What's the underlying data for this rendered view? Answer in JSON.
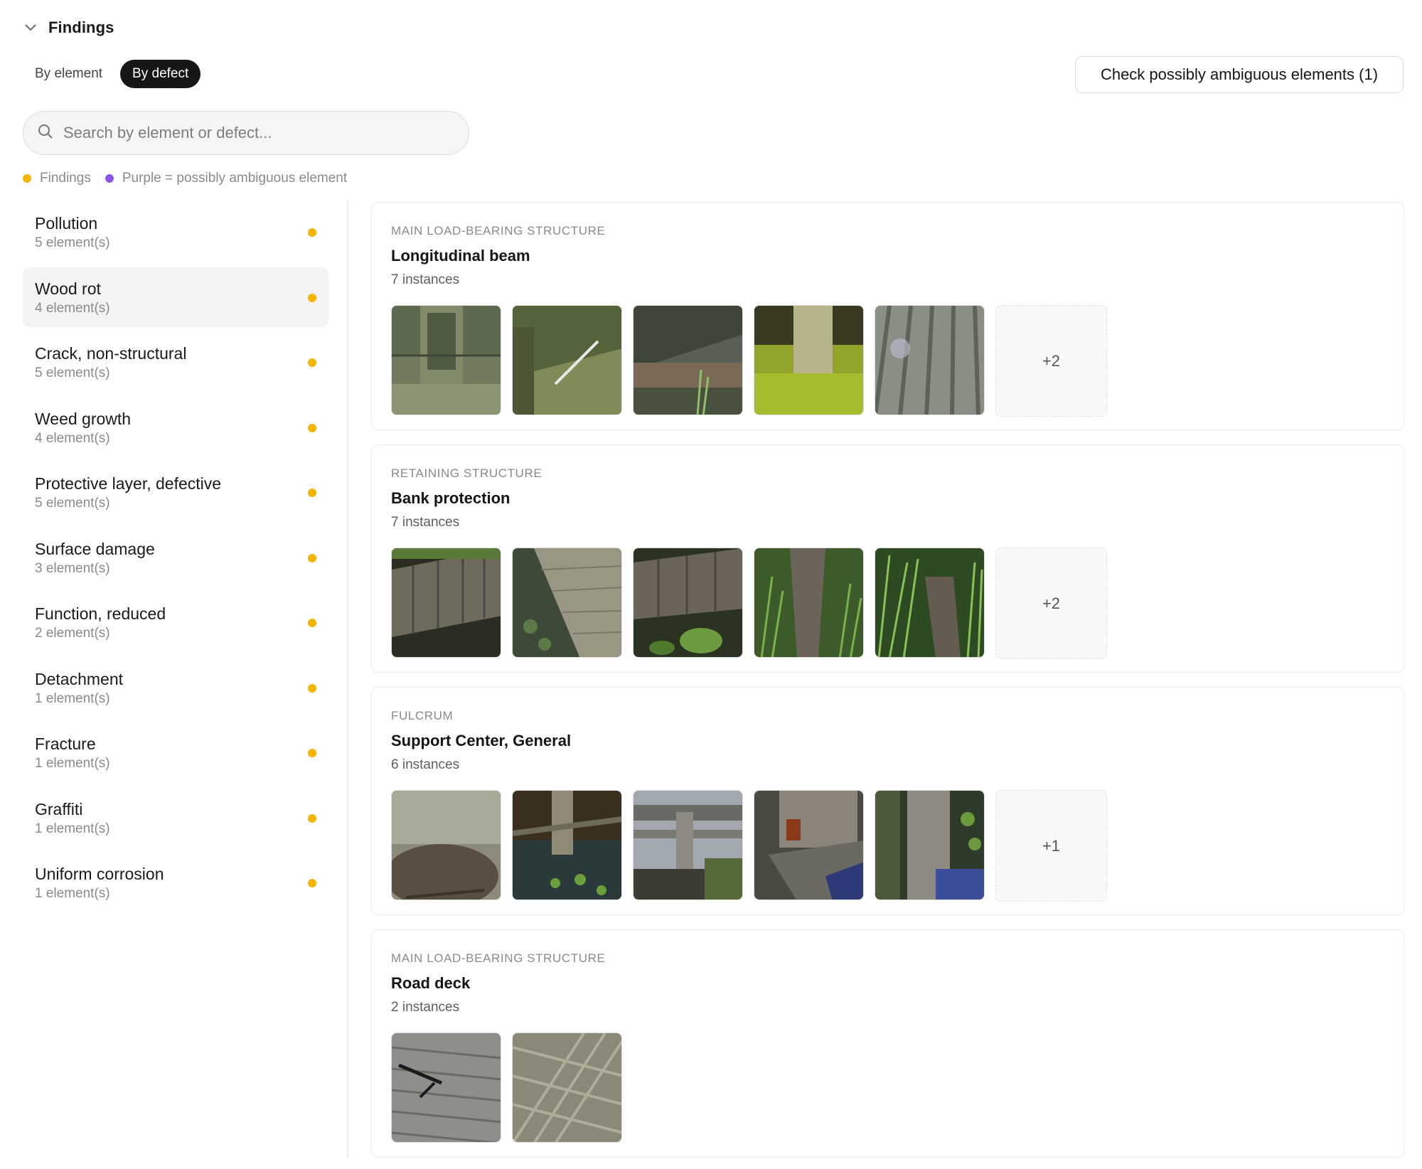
{
  "header": {
    "title": "Findings"
  },
  "toggle": {
    "by_element": "By element",
    "by_defect": "By defect"
  },
  "check_button": "Check possibly ambiguous elements (1)",
  "search": {
    "placeholder": "Search by element or defect..."
  },
  "legend": {
    "findings": "Findings",
    "ambiguous": "Purple = possibly ambiguous element",
    "findings_color": "#f5b400",
    "ambiguous_color": "#8b55e8"
  },
  "sidebar": {
    "items": [
      {
        "name": "Pollution",
        "count": "5 element(s)"
      },
      {
        "name": "Wood rot",
        "count": "4 element(s)"
      },
      {
        "name": "Crack, non-structural",
        "count": "5 element(s)"
      },
      {
        "name": "Weed growth",
        "count": "4 element(s)"
      },
      {
        "name": "Protective layer, defective",
        "count": "5 element(s)"
      },
      {
        "name": "Surface damage",
        "count": "3 element(s)"
      },
      {
        "name": "Function, reduced",
        "count": "2 element(s)"
      },
      {
        "name": "Detachment",
        "count": "1 element(s)"
      },
      {
        "name": "Fracture",
        "count": "1 element(s)"
      },
      {
        "name": "Graffiti",
        "count": "1 element(s)"
      },
      {
        "name": "Uniform corrosion",
        "count": "1 element(s)"
      }
    ],
    "selected": "Wood rot"
  },
  "cards": [
    {
      "category": "MAIN LOAD-BEARING STRUCTURE",
      "title": "Longitudinal beam",
      "count": "7 instances",
      "more": "+2"
    },
    {
      "category": "RETAINING STRUCTURE",
      "title": "Bank protection",
      "count": "7 instances",
      "more": "+2"
    },
    {
      "category": "FULCRUM",
      "title": "Support Center, General",
      "count": "6 instances",
      "more": "+1"
    },
    {
      "category": "MAIN LOAD-BEARING STRUCTURE",
      "title": "Road deck",
      "count": "2 instances"
    }
  ]
}
